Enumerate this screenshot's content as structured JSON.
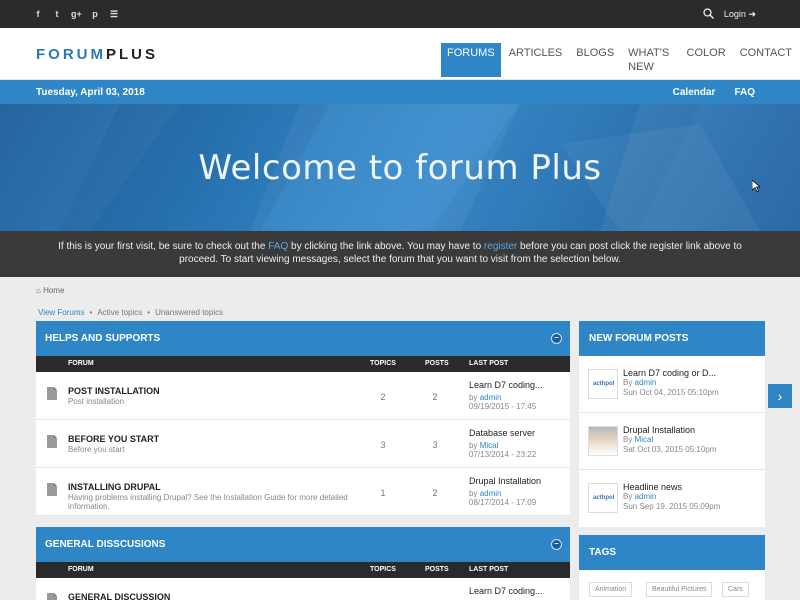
{
  "topbar": {
    "social": [
      {
        "icon": "facebook-icon",
        "glyph": "f"
      },
      {
        "icon": "twitter-icon",
        "glyph": "t"
      },
      {
        "icon": "google-plus-icon",
        "glyph": "g+"
      },
      {
        "icon": "pinterest-icon",
        "glyph": "p"
      },
      {
        "icon": "rss-icon",
        "glyph": "☰"
      }
    ],
    "search_icon": "search-icon",
    "login_label": "Login"
  },
  "header": {
    "logo_part1": "FORUM",
    "logo_part2": "PLUS",
    "nav": [
      "FORUMS",
      "ARTICLES",
      "BLOGS",
      "WHAT'S NEW",
      "COLOR",
      "CONTACT"
    ],
    "active_nav": "FORUMS"
  },
  "datebar": {
    "date": "Tuesday, April 03, 2018",
    "calendar": "Calendar",
    "faq": "FAQ"
  },
  "hero": {
    "title": "Welcome to forum Plus"
  },
  "notice": {
    "line1_a": "If this is your first visit, be sure to check out the ",
    "faq_link": "FAQ",
    "line1_b": " by clicking the link above. You may have to ",
    "register_link": "register",
    "line1_c": " before you can post click the register link above to",
    "line2": "proceed. To start viewing messages, select the forum that you want to visit from the selection below."
  },
  "breadcrumb": {
    "home": "Home"
  },
  "subnav": [
    "View Forums",
    "Active topics",
    "Unanswered topics"
  ],
  "columns": {
    "forum": "FORUM",
    "topics": "TOPICS",
    "posts": "POSTS",
    "last_post": "LAST POST"
  },
  "sections": [
    {
      "title": "HELPS AND SUPPORTS",
      "rows": [
        {
          "title": "POST INSTALLATION",
          "desc": "Post installation",
          "topics": "2",
          "posts": "2",
          "last_title": "Learn D7 coding...",
          "by": "by",
          "user": "admin",
          "date": "09/19/2015 - 17:45"
        },
        {
          "title": "BEFORE YOU START",
          "desc": "Before you start",
          "topics": "3",
          "posts": "3",
          "last_title": "Database server",
          "by": "by",
          "user": "Mical",
          "date": "07/13/2014 - 23:22"
        },
        {
          "title": "INSTALLING DRUPAL",
          "desc": "Having problems installing Drupal? See the Installation Guide for more detailed information.",
          "topics": "1",
          "posts": "2",
          "last_title": "Drupal Installation",
          "by": "by",
          "user": "admin",
          "date": "08/17/2014 - 17:09"
        }
      ]
    },
    {
      "title": "GENERAL DISSCUSIONS",
      "rows": [
        {
          "title": "GENERAL DISCUSSION",
          "last_title": "Learn D7 coding..."
        }
      ]
    }
  ],
  "new_posts": {
    "title": "NEW FORUM POSTS",
    "items": [
      {
        "title": "Learn D7 coding or D...",
        "by": "By",
        "user": "admin",
        "date": "Sun Oct 04, 2015 05:10pm",
        "thumb": "acthpol"
      },
      {
        "title": "Drupal Installation",
        "by": "By",
        "user": "Mical",
        "date": "Sat Oct 03, 2015 05:10pm",
        "thumb": ""
      },
      {
        "title": "Headline news",
        "by": "By",
        "user": "admin",
        "date": "Sun Sep 19, 2015 05:09pm",
        "thumb": "acthpol"
      }
    ]
  },
  "tags": {
    "title": "TAGS",
    "items": [
      "Animation",
      "Beautiful Pictures",
      "Cars"
    ]
  },
  "colors": {
    "accent": "#2e86c7",
    "dark": "#2b2b2b"
  }
}
